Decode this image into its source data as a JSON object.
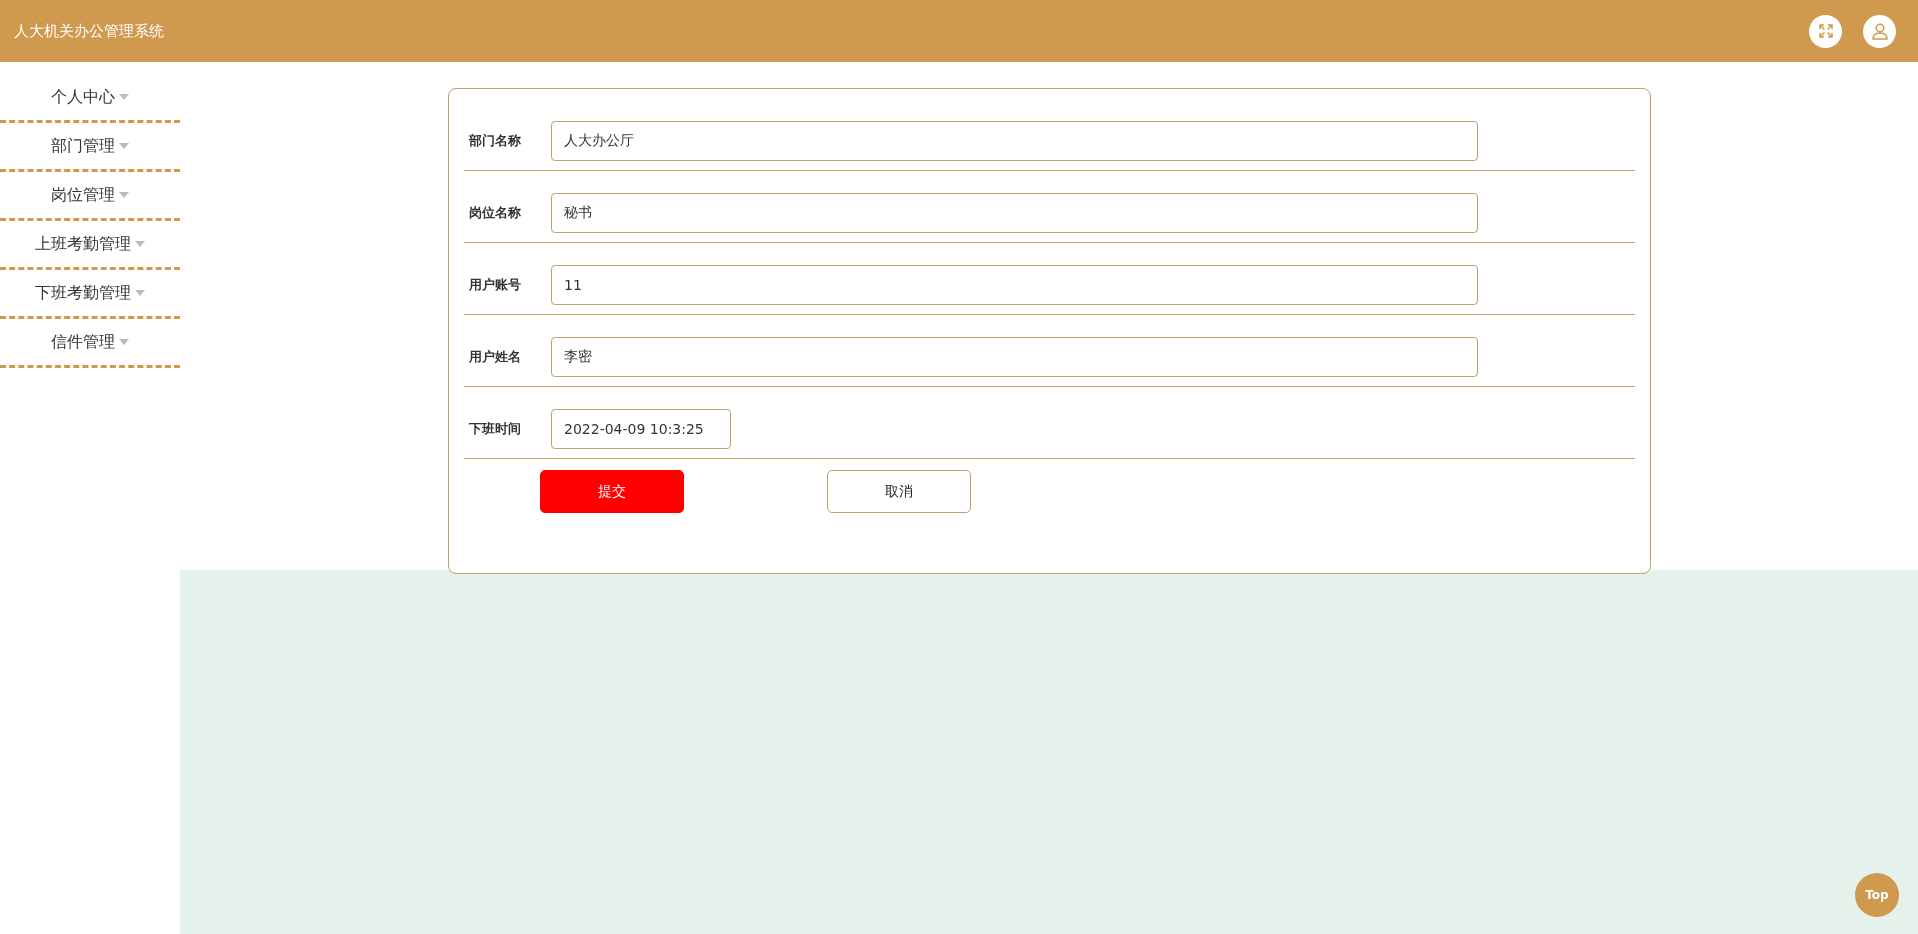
{
  "header": {
    "title": "人大机关办公管理系统"
  },
  "sidebar": {
    "items": [
      {
        "label": "个人中心"
      },
      {
        "label": "部门管理"
      },
      {
        "label": "岗位管理"
      },
      {
        "label": "上班考勤管理"
      },
      {
        "label": "下班考勤管理"
      },
      {
        "label": "信件管理"
      }
    ]
  },
  "form": {
    "fields": [
      {
        "label": "部门名称",
        "value": "人大办公厅",
        "kind": "text"
      },
      {
        "label": "岗位名称",
        "value": "秘书",
        "kind": "text"
      },
      {
        "label": "用户账号",
        "value": "11",
        "kind": "text"
      },
      {
        "label": "用户姓名",
        "value": "李密",
        "kind": "text"
      },
      {
        "label": "下班时间",
        "value": "2022-04-09 10:3:25",
        "kind": "datetime"
      }
    ],
    "buttons": [
      {
        "label": "提交",
        "kind": "primary"
      },
      {
        "label": "取消",
        "kind": "secondary"
      }
    ]
  },
  "top_button": {
    "label": "Top"
  }
}
